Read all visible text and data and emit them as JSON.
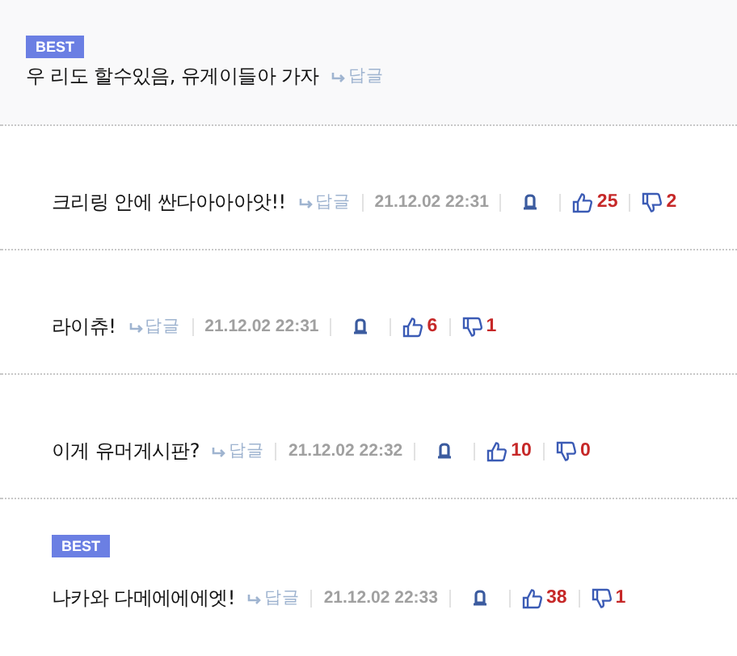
{
  "comments": [
    {
      "kind": "top",
      "best": true,
      "badge": "BEST",
      "text": "우 리도 할수있음, 유게이들아 가자",
      "reply": "답글"
    },
    {
      "kind": "normal",
      "best": false,
      "text": "크리링 안에 싼다아아아앗!!",
      "reply": "답글",
      "date": "21.12.02 22:31",
      "likes": "25",
      "dislikes": "2"
    },
    {
      "kind": "normal",
      "best": false,
      "text": "라이츄!",
      "reply": "답글",
      "date": "21.12.02 22:31",
      "likes": "6",
      "dislikes": "1"
    },
    {
      "kind": "normal",
      "best": false,
      "text": "이게 유머게시판?",
      "reply": "답글",
      "date": "21.12.02 22:32",
      "likes": "10",
      "dislikes": "0"
    },
    {
      "kind": "normal",
      "best": true,
      "badge": "BEST",
      "text": "나카와 다메에에에엣!",
      "reply": "답글",
      "date": "21.12.02 22:33",
      "likes": "38",
      "dislikes": "1"
    }
  ]
}
